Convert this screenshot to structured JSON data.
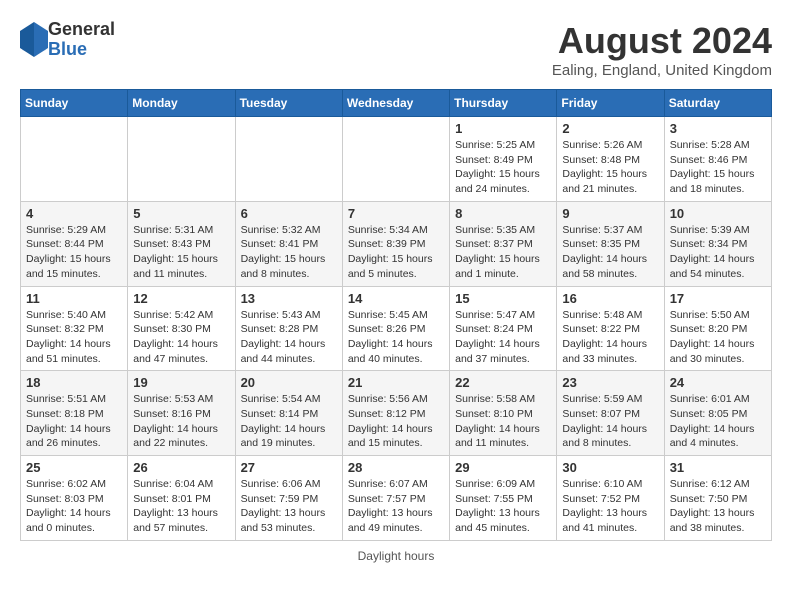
{
  "header": {
    "logo_general": "General",
    "logo_blue": "Blue",
    "month_title": "August 2024",
    "subtitle": "Ealing, England, United Kingdom"
  },
  "days_of_week": [
    "Sunday",
    "Monday",
    "Tuesday",
    "Wednesday",
    "Thursday",
    "Friday",
    "Saturday"
  ],
  "weeks": [
    [
      {
        "day": "",
        "info": ""
      },
      {
        "day": "",
        "info": ""
      },
      {
        "day": "",
        "info": ""
      },
      {
        "day": "",
        "info": ""
      },
      {
        "day": "1",
        "info": "Sunrise: 5:25 AM\nSunset: 8:49 PM\nDaylight: 15 hours and 24 minutes."
      },
      {
        "day": "2",
        "info": "Sunrise: 5:26 AM\nSunset: 8:48 PM\nDaylight: 15 hours and 21 minutes."
      },
      {
        "day": "3",
        "info": "Sunrise: 5:28 AM\nSunset: 8:46 PM\nDaylight: 15 hours and 18 minutes."
      }
    ],
    [
      {
        "day": "4",
        "info": "Sunrise: 5:29 AM\nSunset: 8:44 PM\nDaylight: 15 hours and 15 minutes."
      },
      {
        "day": "5",
        "info": "Sunrise: 5:31 AM\nSunset: 8:43 PM\nDaylight: 15 hours and 11 minutes."
      },
      {
        "day": "6",
        "info": "Sunrise: 5:32 AM\nSunset: 8:41 PM\nDaylight: 15 hours and 8 minutes."
      },
      {
        "day": "7",
        "info": "Sunrise: 5:34 AM\nSunset: 8:39 PM\nDaylight: 15 hours and 5 minutes."
      },
      {
        "day": "8",
        "info": "Sunrise: 5:35 AM\nSunset: 8:37 PM\nDaylight: 15 hours and 1 minute."
      },
      {
        "day": "9",
        "info": "Sunrise: 5:37 AM\nSunset: 8:35 PM\nDaylight: 14 hours and 58 minutes."
      },
      {
        "day": "10",
        "info": "Sunrise: 5:39 AM\nSunset: 8:34 PM\nDaylight: 14 hours and 54 minutes."
      }
    ],
    [
      {
        "day": "11",
        "info": "Sunrise: 5:40 AM\nSunset: 8:32 PM\nDaylight: 14 hours and 51 minutes."
      },
      {
        "day": "12",
        "info": "Sunrise: 5:42 AM\nSunset: 8:30 PM\nDaylight: 14 hours and 47 minutes."
      },
      {
        "day": "13",
        "info": "Sunrise: 5:43 AM\nSunset: 8:28 PM\nDaylight: 14 hours and 44 minutes."
      },
      {
        "day": "14",
        "info": "Sunrise: 5:45 AM\nSunset: 8:26 PM\nDaylight: 14 hours and 40 minutes."
      },
      {
        "day": "15",
        "info": "Sunrise: 5:47 AM\nSunset: 8:24 PM\nDaylight: 14 hours and 37 minutes."
      },
      {
        "day": "16",
        "info": "Sunrise: 5:48 AM\nSunset: 8:22 PM\nDaylight: 14 hours and 33 minutes."
      },
      {
        "day": "17",
        "info": "Sunrise: 5:50 AM\nSunset: 8:20 PM\nDaylight: 14 hours and 30 minutes."
      }
    ],
    [
      {
        "day": "18",
        "info": "Sunrise: 5:51 AM\nSunset: 8:18 PM\nDaylight: 14 hours and 26 minutes."
      },
      {
        "day": "19",
        "info": "Sunrise: 5:53 AM\nSunset: 8:16 PM\nDaylight: 14 hours and 22 minutes."
      },
      {
        "day": "20",
        "info": "Sunrise: 5:54 AM\nSunset: 8:14 PM\nDaylight: 14 hours and 19 minutes."
      },
      {
        "day": "21",
        "info": "Sunrise: 5:56 AM\nSunset: 8:12 PM\nDaylight: 14 hours and 15 minutes."
      },
      {
        "day": "22",
        "info": "Sunrise: 5:58 AM\nSunset: 8:10 PM\nDaylight: 14 hours and 11 minutes."
      },
      {
        "day": "23",
        "info": "Sunrise: 5:59 AM\nSunset: 8:07 PM\nDaylight: 14 hours and 8 minutes."
      },
      {
        "day": "24",
        "info": "Sunrise: 6:01 AM\nSunset: 8:05 PM\nDaylight: 14 hours and 4 minutes."
      }
    ],
    [
      {
        "day": "25",
        "info": "Sunrise: 6:02 AM\nSunset: 8:03 PM\nDaylight: 14 hours and 0 minutes."
      },
      {
        "day": "26",
        "info": "Sunrise: 6:04 AM\nSunset: 8:01 PM\nDaylight: 13 hours and 57 minutes."
      },
      {
        "day": "27",
        "info": "Sunrise: 6:06 AM\nSunset: 7:59 PM\nDaylight: 13 hours and 53 minutes."
      },
      {
        "day": "28",
        "info": "Sunrise: 6:07 AM\nSunset: 7:57 PM\nDaylight: 13 hours and 49 minutes."
      },
      {
        "day": "29",
        "info": "Sunrise: 6:09 AM\nSunset: 7:55 PM\nDaylight: 13 hours and 45 minutes."
      },
      {
        "day": "30",
        "info": "Sunrise: 6:10 AM\nSunset: 7:52 PM\nDaylight: 13 hours and 41 minutes."
      },
      {
        "day": "31",
        "info": "Sunrise: 6:12 AM\nSunset: 7:50 PM\nDaylight: 13 hours and 38 minutes."
      }
    ]
  ],
  "footer": "Daylight hours"
}
